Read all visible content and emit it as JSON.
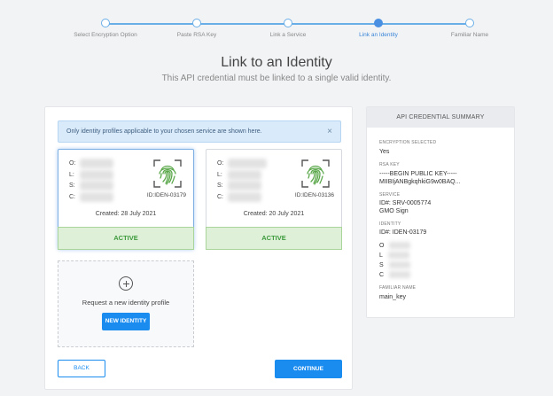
{
  "stepper": {
    "steps": [
      {
        "label": "Select Encryption Option"
      },
      {
        "label": "Paste RSA Key"
      },
      {
        "label": "Link a Service"
      },
      {
        "label": "Link an Identity"
      },
      {
        "label": "Familiar Name"
      }
    ]
  },
  "page": {
    "title": "Link to an Identity",
    "subtitle": "This API credential must be linked to a single valid identity."
  },
  "notice": {
    "text": "Only identity profiles applicable to your chosen service are shown here.",
    "close": "×"
  },
  "identity_cards": [
    {
      "field_labels": [
        "O:",
        "L:",
        "S:",
        "C:"
      ],
      "id": "ID:IDEN-03179",
      "created": "Created: 28 July 2021",
      "status": "ACTIVE"
    },
    {
      "field_labels": [
        "O:",
        "L:",
        "S:",
        "C:"
      ],
      "id": "ID:IDEN-03136",
      "created": "Created: 20 July 2021",
      "status": "ACTIVE"
    }
  ],
  "new_identity": {
    "prompt": "Request a new identity profile",
    "button": "NEW IDENTITY"
  },
  "actions": {
    "back": "BACK",
    "continue": "CONTINUE"
  },
  "summary": {
    "title": "API CREDENTIAL SUMMARY",
    "encryption_label": "ENCRYPTION SELECTED",
    "encryption_value": "Yes",
    "rsa_label": "RSA KEY",
    "rsa_line1": "-----BEGIN PUBLIC KEY-----",
    "rsa_line2": "MIIBIjANBgkqhkiG9w0BAQ...",
    "service_label": "SERVICE",
    "service_id": "ID#: SRV-0005774",
    "service_name": "GMO Sign",
    "identity_label": "IDENTITY",
    "identity_id": "ID#:  IDEN-03179",
    "identity_fields": [
      "O",
      "L",
      "S",
      "C"
    ],
    "familiar_label": "FAMILIAR NAME",
    "familiar_value": "main_key"
  },
  "colors": {
    "accent": "#1a8cf0",
    "active_green": "#3c9a3c",
    "fingerprint_green": "#5aa84a"
  },
  "icons": [
    "fingerprint-icon",
    "plus-circle-icon",
    "close-icon"
  ]
}
